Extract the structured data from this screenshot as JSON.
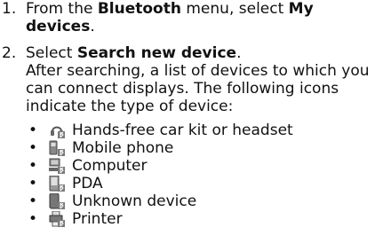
{
  "step1": {
    "number": "1.",
    "text_before": "From the ",
    "menu": "Bluetooth",
    "text_middle": " menu, select ",
    "option": "My devices",
    "text_after": "."
  },
  "step2": {
    "number": "2.",
    "text_before": "Select ",
    "option": "Search new device",
    "text_after": ".",
    "line_1": "After searching, a list of devices to which you",
    "line_2": "can connect displays. The following icons",
    "line_3": "indicate the type of device:"
  },
  "bullet_char": "•",
  "devices": [
    {
      "icon": "headset-icon",
      "label": "Hands-free car kit or headset"
    },
    {
      "icon": "mobile-phone-icon",
      "label": "Mobile phone"
    },
    {
      "icon": "computer-icon",
      "label": "Computer"
    },
    {
      "icon": "pda-icon",
      "label": "PDA"
    },
    {
      "icon": "unknown-device-icon",
      "label": "Unknown device"
    },
    {
      "icon": "printer-icon",
      "label": "Printer"
    }
  ]
}
